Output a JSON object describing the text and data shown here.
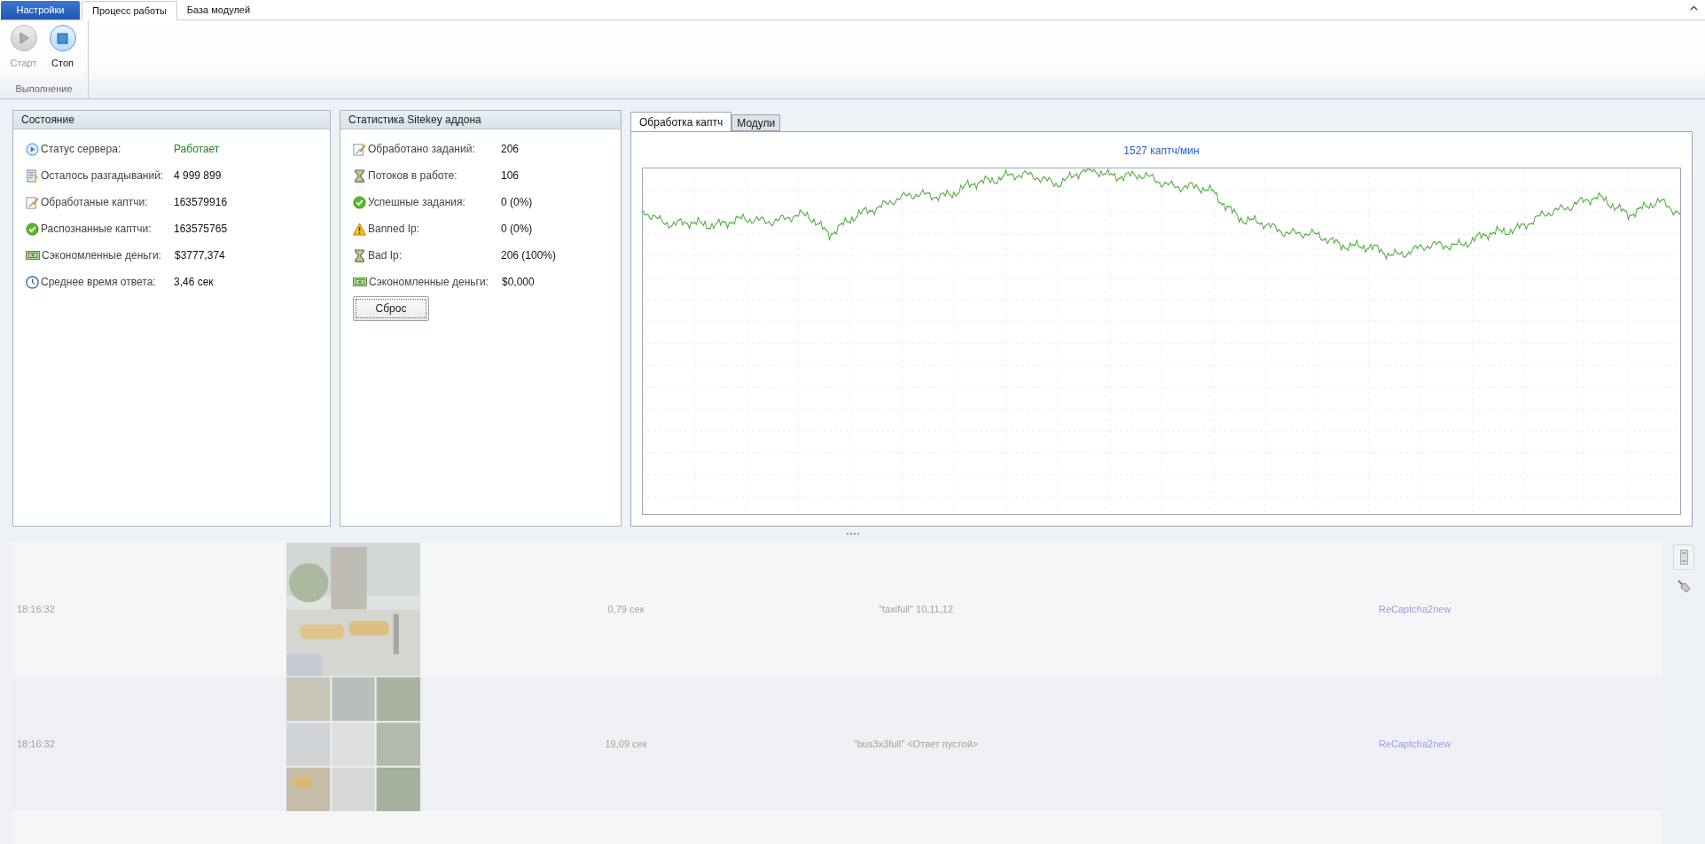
{
  "app_menu": {
    "label": "Настройки"
  },
  "tabs": [
    {
      "label": "Процесс работы",
      "selected": true
    },
    {
      "label": "База модулей",
      "selected": false
    }
  ],
  "ribbon_group": {
    "title": "Выполнение",
    "buttons": [
      {
        "label": "Старт",
        "kind": "start",
        "disabled": true
      },
      {
        "label": "Стоп",
        "kind": "stop",
        "disabled": false
      }
    ]
  },
  "state_panel": {
    "title": "Состояние",
    "rows": [
      {
        "label": "Статус сервера:",
        "value": "Работает",
        "color": "#1a8a1a"
      },
      {
        "label": "Осталось разгадываний:",
        "value": "4 999 899"
      },
      {
        "label": "Обработаные каптчи:",
        "value": "163579916"
      },
      {
        "label": "Распознанные каптчи:",
        "value": "163575765"
      },
      {
        "label": "Сэкономленные деньги:",
        "value": "$3777,374"
      },
      {
        "label": "Среднее время ответа:",
        "value": "3,46 сек"
      }
    ]
  },
  "sitekey_panel": {
    "title": "Статистика Sitekey аддона",
    "rows": [
      {
        "label": "Обработано заданий:",
        "value": "206"
      },
      {
        "label": "Потоков в работе:",
        "value": "106"
      },
      {
        "label": "Успешные задания:",
        "value": "0 (0%)"
      },
      {
        "label": "Banned Ip:",
        "value": "0 (0%)"
      },
      {
        "label": "Bad Ip:",
        "value": "206 (100%)"
      },
      {
        "label": "Сэкономленные деньги:",
        "value": "$0,000"
      }
    ],
    "reset_button": "Сброс"
  },
  "chart_tabs": [
    {
      "label": "Обработка каптч",
      "selected": true
    },
    {
      "label": "Модули",
      "selected": false
    }
  ],
  "chart_title": "1527 каптч/мин",
  "log_rows": [
    {
      "time": "18:16:32",
      "kind": "single",
      "duration": "0,79 сек",
      "answer": "\"taxifull\" 10,11,12",
      "module": "ReCaptcha2new"
    },
    {
      "time": "18:16:32",
      "kind": "grid",
      "duration": "19,09 сек",
      "answer": "\"bus3x3full\" <Ответ пустой>",
      "module": "ReCaptcha2new"
    }
  ]
}
